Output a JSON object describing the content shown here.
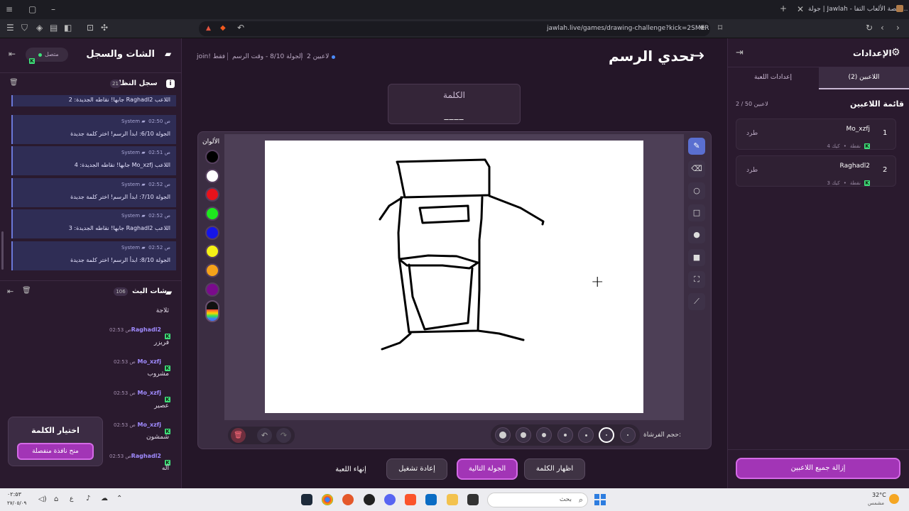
{
  "browser": {
    "tab_title": "جولة | Jawlah - منصة الألعاب التفا...",
    "url": "jawlah.live/games/drawing-challenge?kick=2SMER"
  },
  "left": {
    "header_title": "الشات والسجل",
    "status_label": "متصل",
    "system_log_title": "سجل النظام",
    "system_log_count": "21",
    "log_top_partial": "اللاعب Raghadl2 جابها! نقاطه الجديدة: 2",
    "log": [
      {
        "sender": "System",
        "time": "02:50 ص",
        "text": "الجولة 6/10: ابدأ الرسم! اختر كلمة جديدة"
      },
      {
        "sender": "System",
        "time": "02:51 ص",
        "text": "اللاعب Mo_xzfj جابها! نقاطه الجديدة: 4"
      },
      {
        "sender": "System",
        "time": "02:52 ص",
        "text": "الجولة 7/10: ابدأ الرسم! اختر كلمة جديدة"
      },
      {
        "sender": "System",
        "time": "02:52 ص",
        "text": "اللاعب Raghadl2 جابها! نقاطه الجديدة: 3"
      },
      {
        "sender": "System",
        "time": "02:52 ص",
        "text": "الجولة 8/10: ابدأ الرسم! اختر كلمة جديدة"
      }
    ],
    "chat_title": "شات البث",
    "chat_count": "106",
    "chat_top_partial": "ثلاجة",
    "chat": [
      {
        "name": "Raghadl2",
        "time": "02:53 ص",
        "text": "فريزر"
      },
      {
        "name": "Mo_xzfj",
        "time": "02:53 ص",
        "text": "مشروب"
      },
      {
        "name": "Mo_xzfj",
        "time": "02:53 ص",
        "text": "عصير"
      },
      {
        "name": "Mo_xzfj",
        "time": "02:53 ص",
        "text": "شمشون"
      },
      {
        "name": "Raghadl2",
        "time": "02:53 ص",
        "text": "آله"
      }
    ],
    "word_choice_title": "اختيار الكلمة",
    "word_choice_button": "منح نافذة منفصلة"
  },
  "center": {
    "title": "تحدي الرسم",
    "info_players": "2 لاعبين",
    "info_round": "الجولة 8/10 - وقت الرسم",
    "info_join": "join! فقط",
    "word_label": "الكلمة",
    "word_mask": "____",
    "colors_label": "الألوان",
    "colors": [
      "#000000",
      "#ffffff",
      "#e8121b",
      "#1ee81e",
      "#1515e8",
      "#f5f016",
      "#f5a21a",
      "#7a0a8c"
    ],
    "brush_size_label": "حجم الفرشاة:",
    "buttons": {
      "reveal_word": "اظهار الكلمة",
      "next_round": "الجولة التالية",
      "restart": "إعادة تشغيل",
      "end_game": "إنهاء اللعبة"
    }
  },
  "right": {
    "header_title": "الإعدادات",
    "tab_players": "اللاعبين (2)",
    "tab_game_settings": "إعدادات اللعبة",
    "players_list_title": "قائمة اللاعبين",
    "players_count": "2 / 50 لاعبين",
    "players": [
      {
        "rank": "1",
        "name": "Mo_xzfj",
        "platform": "كيك",
        "points": "4 نقطة",
        "kick_label": "طرد"
      },
      {
        "rank": "2",
        "name": "Raghadl2",
        "platform": "كيك",
        "points": "3 نقطة",
        "kick_label": "طرد"
      }
    ],
    "remove_all_button": "إزالة جميع اللاعبين"
  },
  "taskbar": {
    "search_placeholder": "بحث",
    "weather_temp": "32°C",
    "weather_desc": "مشمس",
    "clock_time": "٠٢:٥٣",
    "clock_date": "٢٧/٠٥/٠٩",
    "lang": "ع"
  }
}
